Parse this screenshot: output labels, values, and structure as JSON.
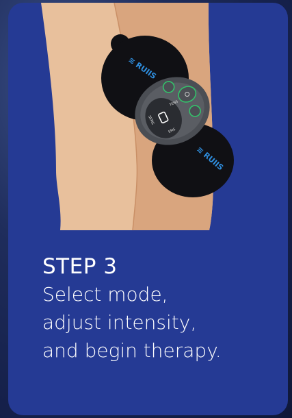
{
  "step": {
    "title": "STEP 3",
    "lines": [
      "Select mode,",
      "adjust intensity,",
      "and begin therapy."
    ]
  },
  "device": {
    "brand_logo": "brand-logo",
    "left_mode_label": "SEMS",
    "right_mode_label": "TENS",
    "bottom_mode_label": "EMS"
  },
  "colors": {
    "card_background": "#253a94",
    "page_background": "#1f2d5c",
    "skin_light": "#e8c09c",
    "skin_dark": "#d9a57e",
    "device_body": "#101014",
    "controller_face": "#5a5d63",
    "button_accent": "#33c26a",
    "logo_accent": "#2f8fe0"
  }
}
